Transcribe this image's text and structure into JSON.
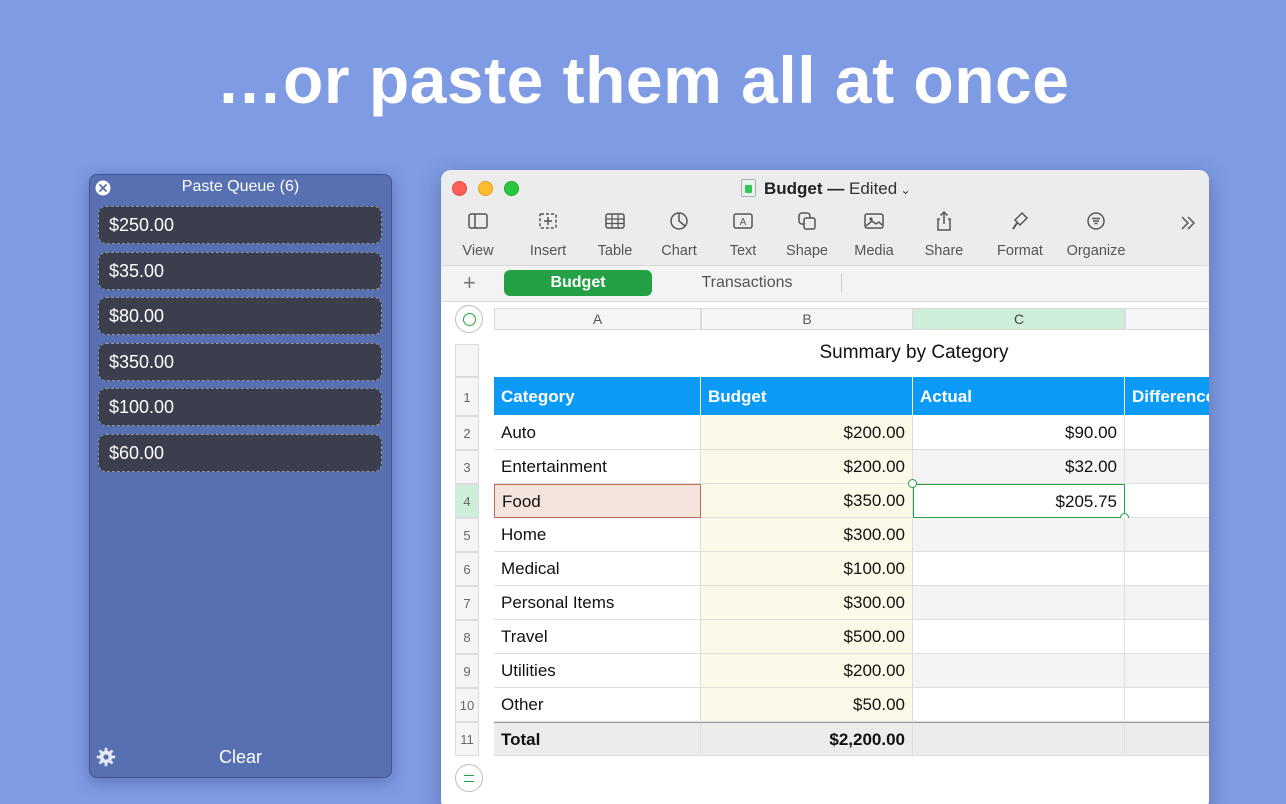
{
  "headline": "…or paste them all at once",
  "queue": {
    "title": "Paste Queue (6)",
    "items": [
      "$250.00",
      "$35.00",
      "$80.00",
      "$350.00",
      "$100.00",
      "$60.00"
    ],
    "clear_label": "Clear"
  },
  "window": {
    "doc_name": "Budget —",
    "doc_status": "Edited",
    "toolbar": [
      {
        "label": "View",
        "icon": "sidebar-icon"
      },
      {
        "label": "Insert",
        "icon": "insert-icon"
      },
      {
        "label": "Table",
        "icon": "table-icon"
      },
      {
        "label": "Chart",
        "icon": "chart-icon"
      },
      {
        "label": "Text",
        "icon": "text-icon"
      },
      {
        "label": "Shape",
        "icon": "shape-icon"
      },
      {
        "label": "Media",
        "icon": "media-icon"
      },
      {
        "label": "Share",
        "icon": "share-icon"
      },
      {
        "label": "Format",
        "icon": "format-icon"
      },
      {
        "label": "Organize",
        "icon": "organize-icon"
      }
    ],
    "tabs": {
      "active": "Budget",
      "inactive": "Transactions"
    },
    "columns": [
      "A",
      "B",
      "C"
    ],
    "table": {
      "title": "Summary by Category",
      "headers": [
        "Category",
        "Budget",
        "Actual",
        "Difference"
      ],
      "rows": [
        {
          "num": "2",
          "category": "Auto",
          "budget": "$200.00",
          "actual": "$90.00"
        },
        {
          "num": "3",
          "category": "Entertainment",
          "budget": "$200.00",
          "actual": "$32.00"
        },
        {
          "num": "4",
          "category": "Food",
          "budget": "$350.00",
          "actual": "$205.75"
        },
        {
          "num": "5",
          "category": "Home",
          "budget": "$300.00",
          "actual": ""
        },
        {
          "num": "6",
          "category": "Medical",
          "budget": "$100.00",
          "actual": ""
        },
        {
          "num": "7",
          "category": "Personal Items",
          "budget": "$300.00",
          "actual": ""
        },
        {
          "num": "8",
          "category": "Travel",
          "budget": "$500.00",
          "actual": ""
        },
        {
          "num": "9",
          "category": "Utilities",
          "budget": "$200.00",
          "actual": ""
        },
        {
          "num": "10",
          "category": "Other",
          "budget": "$50.00",
          "actual": ""
        }
      ],
      "header_row_num": "1",
      "total": {
        "num": "11",
        "label": "Total",
        "budget": "$2,200.00"
      }
    },
    "colors": {
      "header_blue": "#0b9bf7",
      "tab_green": "#24a145",
      "selection_green": "#23a143"
    }
  }
}
